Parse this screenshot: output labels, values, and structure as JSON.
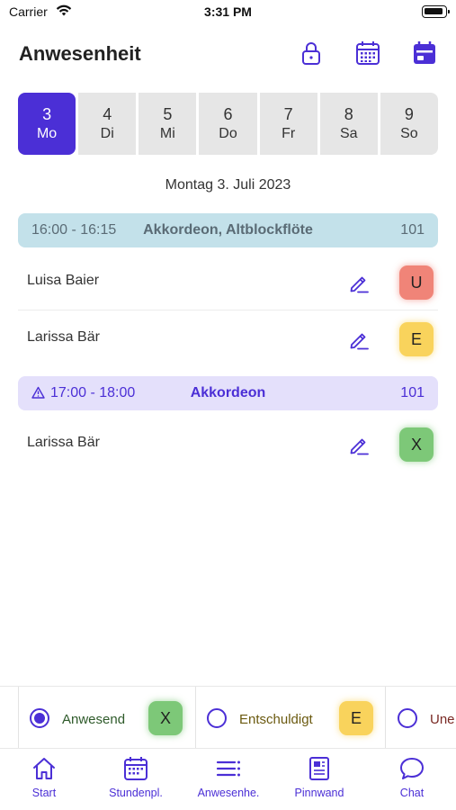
{
  "status_bar": {
    "carrier": "Carrier",
    "time": "3:31 PM"
  },
  "header": {
    "title": "Anwesenheit",
    "icons": [
      "lock-icon",
      "calendar-grid-icon",
      "calendar-filled-icon"
    ]
  },
  "days": [
    {
      "num": "3",
      "weekday": "Mo",
      "selected": true
    },
    {
      "num": "4",
      "weekday": "Di",
      "selected": false
    },
    {
      "num": "5",
      "weekday": "Mi",
      "selected": false
    },
    {
      "num": "6",
      "weekday": "Do",
      "selected": false
    },
    {
      "num": "7",
      "weekday": "Fr",
      "selected": false
    },
    {
      "num": "8",
      "weekday": "Sa",
      "selected": false
    },
    {
      "num": "9",
      "weekday": "So",
      "selected": false
    }
  ],
  "date_label": "Montag 3. Juli 2023",
  "lessons": [
    {
      "time": "16:00 - 16:15",
      "subject": "Akkordeon, Altblockflöte",
      "room": "101",
      "color": "#c3e1ea",
      "students": [
        {
          "name": "Luisa Baier",
          "status": "U",
          "status_color": "#f08478"
        },
        {
          "name": "Larissa Bär",
          "status": "E",
          "status_color": "#f9d35c"
        }
      ]
    },
    {
      "time": "17:00 - 18:00",
      "subject": "Akkordeon",
      "room": "101",
      "color": "#e4e0fb",
      "warning_icon": "warning-triangle-icon",
      "students": [
        {
          "name": "Larissa Bär",
          "status": "X",
          "status_color": "#7dc878"
        }
      ]
    }
  ],
  "legend": [
    {
      "label": "Anwesend",
      "badge": "X",
      "checked": true,
      "label_color": "#2e5a2a"
    },
    {
      "label": "Entschuldigt",
      "badge": "E",
      "checked": false,
      "label_color": "#6b5a10"
    },
    {
      "label": "Une",
      "checked": false,
      "label_color": "#7a2a25"
    }
  ],
  "tabs": [
    {
      "label": "Start",
      "icon": "home-icon"
    },
    {
      "label": "Stundenpl.",
      "icon": "calendar-icon"
    },
    {
      "label": "Anwesenhe.",
      "icon": "list-icon"
    },
    {
      "label": "Pinnwand",
      "icon": "newspaper-icon"
    },
    {
      "label": "Chat",
      "icon": "chat-bubble-icon"
    }
  ],
  "accent_color": "#4b2fd6"
}
